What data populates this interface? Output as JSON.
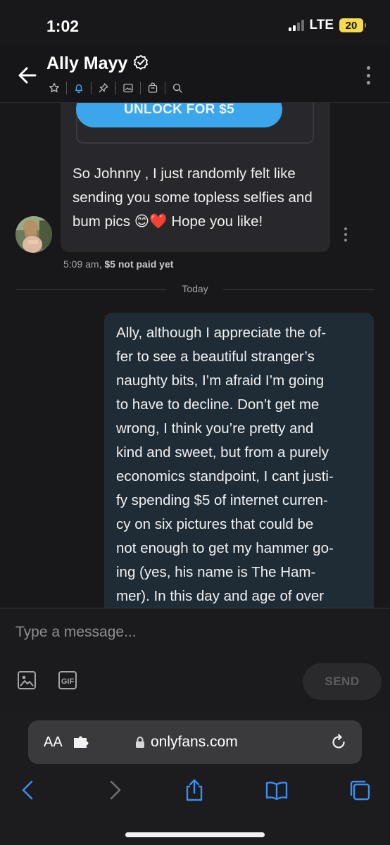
{
  "status": {
    "time": "1:02",
    "network": "LTE",
    "battery": "20",
    "battery_color": "#f5d94e"
  },
  "header": {
    "contact_name": "Ally Mayy",
    "verified": true,
    "icons": [
      "star-icon",
      "bell-icon",
      "pin-icon",
      "image-icon",
      "bag-icon",
      "search-icon"
    ]
  },
  "messages": {
    "incoming": {
      "unlock_label": "UNLOCK FOR $5",
      "text": "So Johnny , I just randomly felt like sending you some topless selfies and bum pics 😊❤️ Hope you like!",
      "time": "5:09 am,",
      "price_status": "$5 not paid yet"
    },
    "divider_label": "Today",
    "outgoing": {
      "text": "Ally, although I appreciate the of-\nfer to see a beautiful stranger’s\nnaughty bits, I’m afraid I’m going\nto have to decline. Don’t get me\nwrong, I think you’re pretty and\nkind and sweet, but from a purely\neconomics standpoint, I cant justi-\nfy spending $5 of internet curren-\ncy on six pictures that could be\nnot enough to get my hammer go-\ning (yes, his name is The Ham-\nmer). In this day and age of over"
    }
  },
  "composer": {
    "placeholder": "Type a message...",
    "send_label": "SEND"
  },
  "browser": {
    "aa_label": "AA",
    "url": "onlyfans.com"
  },
  "colors": {
    "accent": "#3ba6eb",
    "incoming_bubble": "#28282c",
    "outgoing_bubble": "#1f2c35"
  }
}
